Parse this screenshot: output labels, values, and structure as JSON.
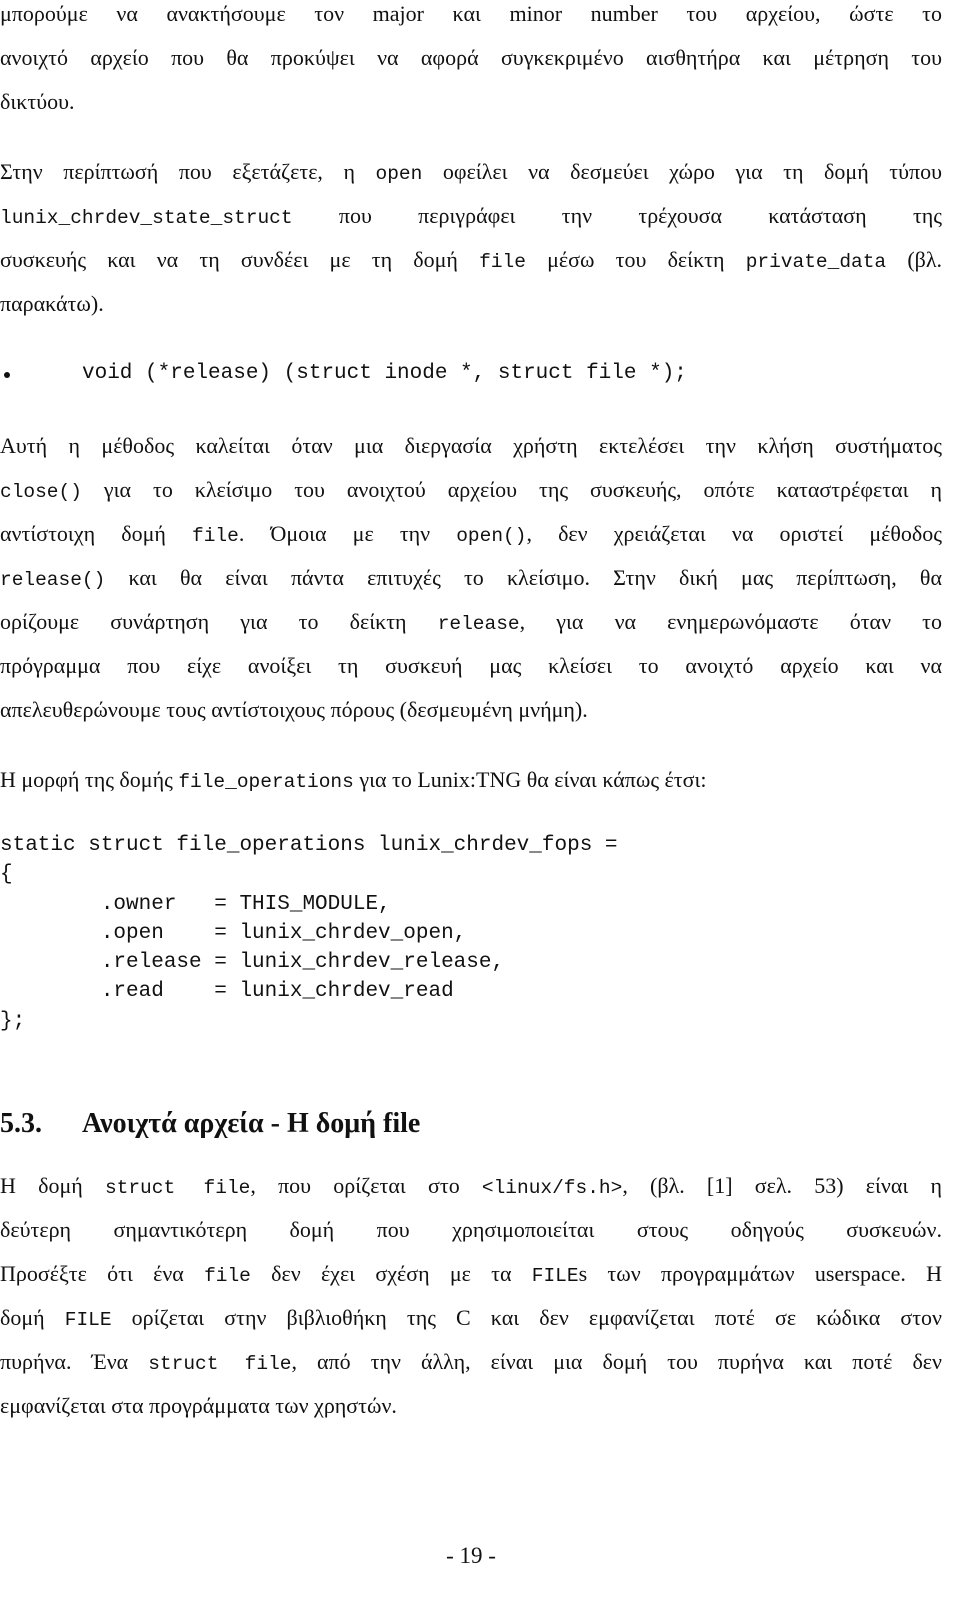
{
  "paragraph1": {
    "lines": [
      [
        "μπορούμε να ανακτήσουμε τον major και minor number του αρχείου, ώστε το"
      ],
      [
        "ανοιχτό αρχείο που θα προκύψει να αφορά συγκεκριμένο αισθητήρα και μέτρηση του"
      ],
      [
        "δικτύου."
      ]
    ]
  },
  "paragraph2": {
    "l1_a": "Στην περίπτωσή που εξετάζετε, η ",
    "l1_code": "open",
    "l1_b": " οφείλει να δεσμεύει χώρο για τη δομή τύπου",
    "l2_code": "lunix_chrdev_state_struct",
    "l2_b": " που περιγράφει την τρέχουσα κατάσταση της",
    "l3_a": "συσκευής και να τη συνδέει με τη δομή ",
    "l3_code1": "file",
    "l3_b": " μέσω του δείκτη ",
    "l3_code2": "private_data",
    "l3_c": " (βλ.",
    "l4": "παρακάτω)."
  },
  "bullet": {
    "code": "void (*release) (struct inode *, struct file *);"
  },
  "paragraph3": {
    "l1": "Αυτή η μέθοδος καλείται όταν μια διεργασία χρήστη εκτελέσει την κλήση συστήματος",
    "l2_code": "close()",
    "l2_b": " για το κλείσιμο του ανοιχτού αρχείου της συσκευής, οπότε καταστρέφεται η",
    "l3_a": "αντίστοιχη δομή ",
    "l3_code1": "file",
    "l3_b": ". Όμοια με την ",
    "l3_code2": "open()",
    "l3_c": ", δεν χρειάζεται να οριστεί μέθοδος",
    "l4_code": "release()",
    "l4_b": " και θα είναι πάντα επιτυχές το κλείσιμο. Στην δική μας περίπτωση, θα",
    "l5_a": "ορίζουμε συνάρτηση για το δείκτη ",
    "l5_code": "release",
    "l5_b": ", για να ενημερωνόμαστε όταν το",
    "l6": "πρόγραμμα που είχε ανοίξει τη συσκευή μας κλείσει το ανοιχτό αρχείο και να",
    "l7": "απελευθερώνουμε τους αντίστοιχους πόρους (δεσμευμένη μνήμη)."
  },
  "paragraph4": {
    "a": "Η μορφή της δομής ",
    "code": "file_operations",
    "b": " για το Lunix:TNG θα είναι κάπως έτσι:"
  },
  "code_block": {
    "text": "static struct file_operations lunix_chrdev_fops =\n{\n        .owner   = THIS_MODULE,\n        .open    = lunix_chrdev_open,\n        .release = lunix_chrdev_release,\n        .read    = lunix_chrdev_read\n};"
  },
  "section": {
    "number": "5.3.",
    "title": "Ανοιχτά αρχεία - Η δομή file"
  },
  "paragraph5": {
    "l1_a": "Η δομή ",
    "l1_code1": "struct file",
    "l1_b": ", που ορίζεται στο ",
    "l1_code2": "<linux/fs.h>",
    "l1_c": ", (βλ. [1] σελ. 53) είναι η",
    "l2": "δεύτερη σημαντικότερη δομή που χρησιμοποιείται στους οδηγούς συσκευών.",
    "l3_a": "Προσέξτε ότι ένα ",
    "l3_code1": "file",
    "l3_b": " δεν έχει σχέση με τα ",
    "l3_code2": "FILE",
    "l3_c": "s των προγραμμάτων userspace. Η",
    "l4_a": "δομή ",
    "l4_code": "FILE",
    "l4_b": " ορίζεται στην βιβλιοθήκη της C και δεν εμφανίζεται ποτέ σε κώδικα στον",
    "l5_a": "πυρήνα. Ένα ",
    "l5_code": "struct file",
    "l5_b": ", από την άλλη, είναι μια δομή του πυρήνα και ποτέ δεν",
    "l6": "εμφανίζεται στα προγράμματα των χρηστών."
  },
  "footer": {
    "page_number": "- 19 -"
  }
}
